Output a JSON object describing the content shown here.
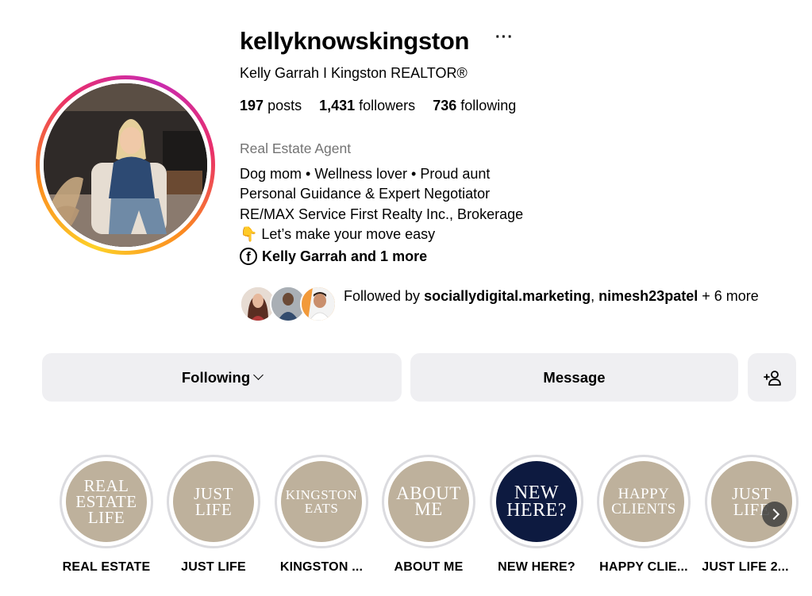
{
  "profile": {
    "username": "kellyknowskingston",
    "more_icon": "···",
    "full_name": "Kelly Garrah I Kingston REALTOR®",
    "stats": {
      "posts_count": "197",
      "posts_label": "posts",
      "followers_count": "1,431",
      "followers_label": "followers",
      "following_count": "736",
      "following_label": "following"
    },
    "category": "Real Estate Agent",
    "bio": [
      "Dog mom • Wellness lover • Proud aunt",
      "Personal Guidance & Expert Negotiator",
      "RE/MAX Service First Realty Inc., Brokerage",
      "👇 Let’s make your move easy"
    ],
    "linked_accounts": {
      "icon": "facebook-icon",
      "text": "Kelly Garrah and 1 more"
    },
    "followed_by": {
      "prefix": "Followed by ",
      "user1": "sociallydigital.marketing",
      "separator": ", ",
      "user2": "nimesh23patel",
      "suffix": " + 6 more"
    }
  },
  "actions": {
    "following_label": "Following",
    "message_label": "Message",
    "add_user_icon": "add-person-icon"
  },
  "highlights": [
    {
      "cover": "REAL ESTATE LIFE",
      "label": "REAL ESTATE"
    },
    {
      "cover": "JUST LIFE",
      "label": "JUST LIFE"
    },
    {
      "cover": "KINGSTON EATS",
      "label": "KINGSTON ..."
    },
    {
      "cover": "ABOUT ME",
      "label": "ABOUT ME"
    },
    {
      "cover": "NEW HERE?",
      "label": "NEW HERE?"
    },
    {
      "cover": "HAPPY CLIENTS",
      "label": "HAPPY CLIE..."
    },
    {
      "cover": "JUST LIFE",
      "label": "JUST LIFE 2..."
    }
  ],
  "colors": {
    "highlight_tan": "#beb19c",
    "highlight_navy": "#0d1a40",
    "button_bg": "#efeff2",
    "muted_text": "#737373"
  }
}
